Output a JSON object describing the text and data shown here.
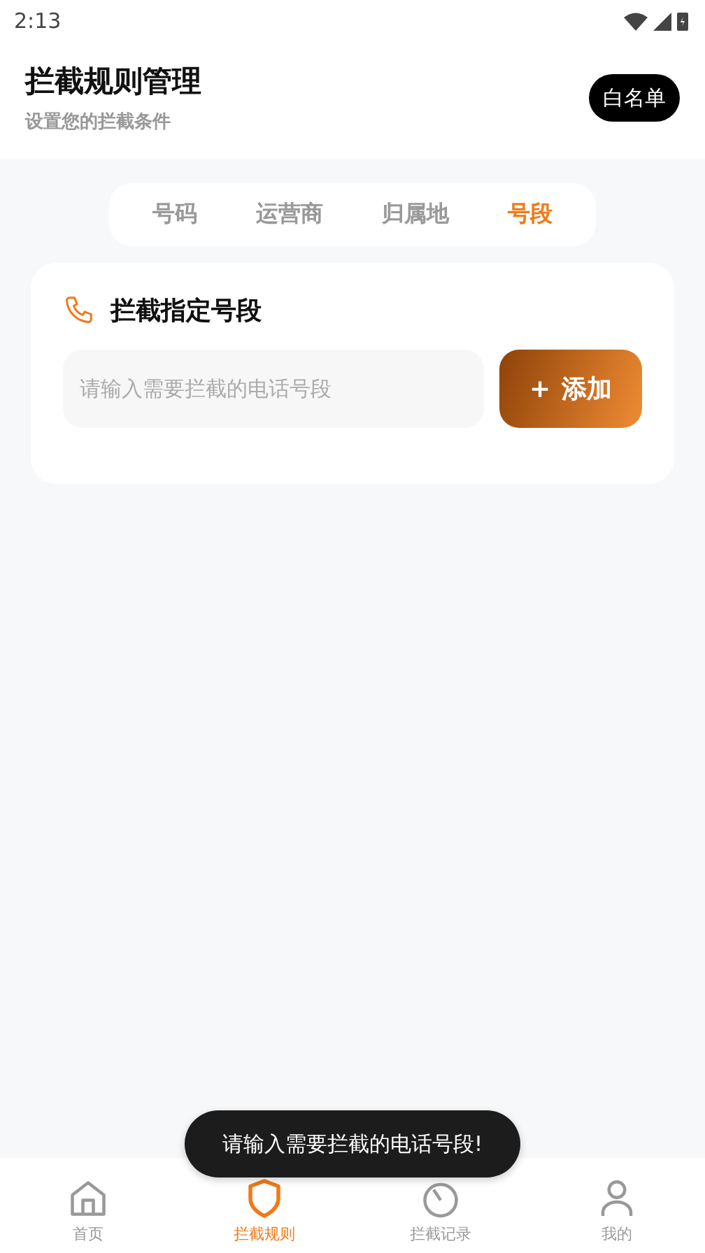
{
  "status_bar": {
    "time": "2:13"
  },
  "header": {
    "title": "拦截规则管理",
    "subtitle": "设置您的拦截条件",
    "whitelist_button": "白名单"
  },
  "tabs": [
    {
      "label": "号码",
      "selected": false
    },
    {
      "label": "运营商",
      "selected": false
    },
    {
      "label": "归属地",
      "selected": false
    },
    {
      "label": "号段",
      "selected": true
    }
  ],
  "card": {
    "title": "拦截指定号段",
    "input": {
      "placeholder": "请输入需要拦截的电话号段"
    },
    "add_button": {
      "icon": "+",
      "label": "添加"
    }
  },
  "toast": "请输入需要拦截的电话号段!",
  "bottom_nav": [
    {
      "kind": "home",
      "label": "首页",
      "selected": false
    },
    {
      "kind": "shield",
      "label": "拦截规则",
      "selected": true
    },
    {
      "kind": "gauge",
      "label": "拦截记录",
      "selected": false
    },
    {
      "kind": "user",
      "label": "我的",
      "selected": false
    }
  ]
}
